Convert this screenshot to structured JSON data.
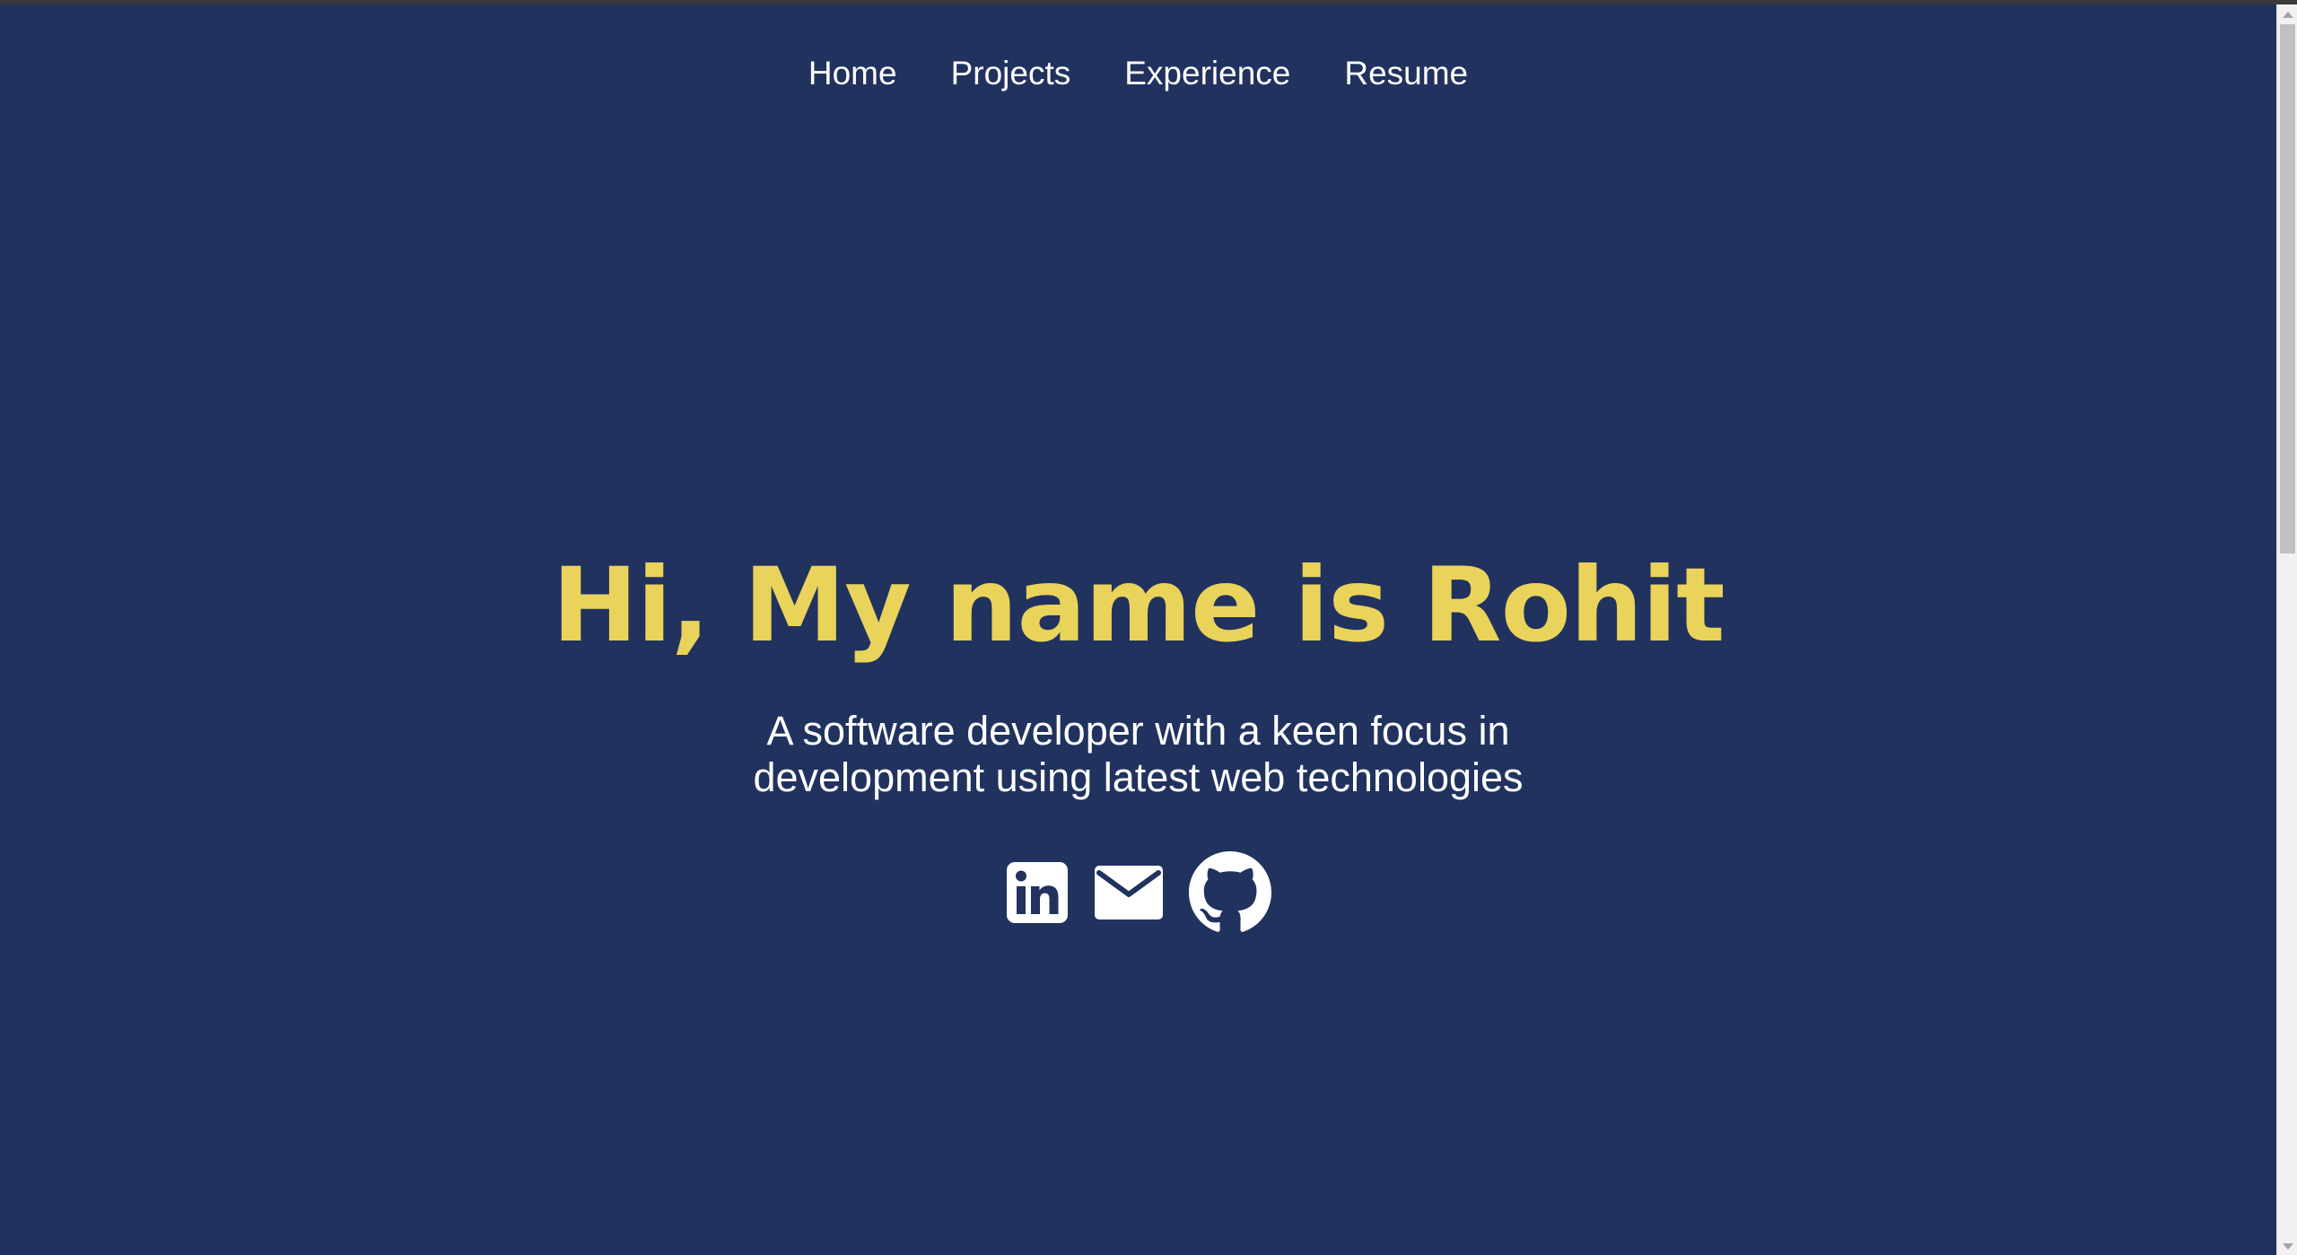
{
  "nav": {
    "items": [
      {
        "label": "Home"
      },
      {
        "label": "Projects"
      },
      {
        "label": "Experience"
      },
      {
        "label": "Resume"
      }
    ]
  },
  "hero": {
    "title": "Hi, My name is Rohit",
    "subtitle": "A software developer with a keen focus in development using latest web technologies"
  },
  "socials": [
    {
      "icon": "linkedin-icon"
    },
    {
      "icon": "email-icon"
    },
    {
      "icon": "github-icon"
    }
  ],
  "colors": {
    "background": "#21325e",
    "accent": "#e9d35b",
    "text": "#ffffff"
  }
}
